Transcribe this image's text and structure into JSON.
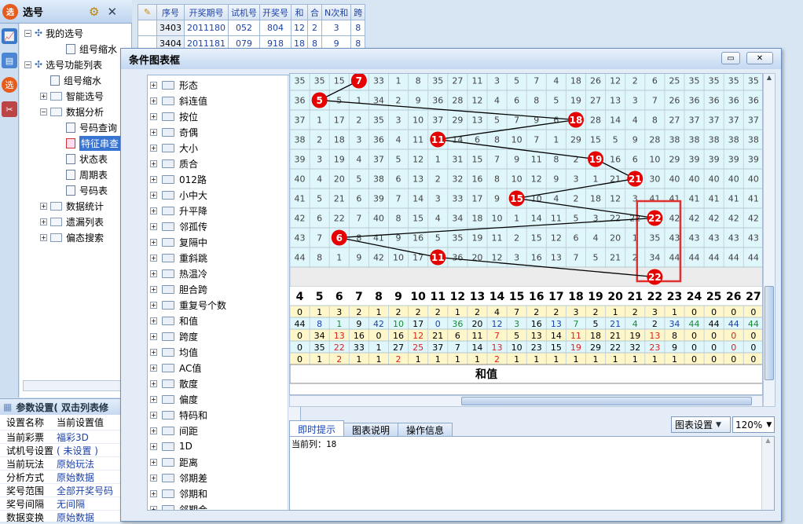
{
  "left_panel": {
    "title": "选号"
  },
  "tree": [
    {
      "label": "我的选号",
      "level": 0,
      "toggle": "−",
      "kind": "node"
    },
    {
      "label": "组号缩水",
      "level": 2,
      "toggle": "",
      "kind": "doc"
    },
    {
      "label": "选号功能列表",
      "level": 0,
      "toggle": "−",
      "kind": "node"
    },
    {
      "label": "组号缩水",
      "level": 1,
      "toggle": "",
      "kind": "doc"
    },
    {
      "label": "智能选号",
      "level": 1,
      "toggle": "+",
      "kind": "folder"
    },
    {
      "label": "数据分析",
      "level": 1,
      "toggle": "−",
      "kind": "folder"
    },
    {
      "label": "号码查询",
      "level": 2,
      "toggle": "",
      "kind": "doc"
    },
    {
      "label": "特征串查",
      "level": 2,
      "toggle": "",
      "kind": "doc",
      "selected": true
    },
    {
      "label": "状态表",
      "level": 2,
      "toggle": "",
      "kind": "doc"
    },
    {
      "label": "周期表",
      "level": 2,
      "toggle": "",
      "kind": "doc"
    },
    {
      "label": "号码表",
      "level": 2,
      "toggle": "",
      "kind": "doc"
    },
    {
      "label": "数据统计",
      "level": 1,
      "toggle": "+",
      "kind": "folder"
    },
    {
      "label": "遗漏列表",
      "level": 1,
      "toggle": "+",
      "kind": "folder"
    },
    {
      "label": "偏态搜索",
      "level": 1,
      "toggle": "+",
      "kind": "folder"
    }
  ],
  "params": {
    "header": "参数设置( 双击列表修",
    "col_name": "设置名称",
    "col_value": "当前设置值",
    "rows": [
      [
        "当前彩票",
        "福彩3D"
      ],
      [
        "试机号设置",
        "( 未设置 )"
      ],
      [
        "当前玩法",
        "原始玩法"
      ],
      [
        "分析方式",
        "原始数据"
      ],
      [
        "奖号范围",
        "全部开奖号码"
      ],
      [
        "奖号间隔",
        "无间隔"
      ],
      [
        "数据变换",
        "原始数据"
      ]
    ]
  },
  "bg_table": {
    "headers": [
      "序号",
      "开奖期号",
      "试机号",
      "开奖号",
      "和",
      "合",
      "N次和",
      "跨"
    ],
    "rows": [
      [
        "3403",
        "2011180",
        "052",
        "804",
        "12",
        "2",
        "3",
        "8"
      ],
      [
        "3404",
        "2011181",
        "079",
        "918",
        "18",
        "8",
        "9",
        "8"
      ]
    ]
  },
  "modal": {
    "title": "条件图表框"
  },
  "conditions": [
    "形态",
    "斜连值",
    "按位",
    "奇偶",
    "大小",
    "质合",
    "012路",
    "小中大",
    "升平降",
    "邻孤传",
    "复隔中",
    "重斜跳",
    "热温冷",
    "胆合跨",
    "重复号个数",
    "和值",
    "跨度",
    "均值",
    "AC值",
    "散度",
    "偏度",
    "特码和",
    "间距",
    "1D",
    "距离",
    "邻期差",
    "邻期和",
    "邻期合"
  ],
  "chart_data": {
    "type": "table",
    "grid_rows": [
      {
        "label": "35",
        "cells": [
          "35",
          "15",
          "7",
          "33",
          "1",
          "8",
          "35",
          "27",
          "11",
          "3",
          "5",
          "7",
          "4",
          "18",
          "26",
          "12",
          "2",
          "6",
          "25",
          "35",
          "35",
          "35",
          "35"
        ]
      },
      {
        "label": "36",
        "cells": [
          "1",
          "5",
          "1",
          "34",
          "2",
          "9",
          "36",
          "28",
          "12",
          "4",
          "6",
          "8",
          "5",
          "19",
          "27",
          "13",
          "3",
          "7",
          "26",
          "36",
          "36",
          "36",
          "36"
        ]
      },
      {
        "label": "37",
        "cells": [
          "1",
          "17",
          "2",
          "35",
          "3",
          "10",
          "37",
          "29",
          "13",
          "5",
          "7",
          "9",
          "6",
          "18",
          "28",
          "14",
          "4",
          "8",
          "27",
          "37",
          "37",
          "37",
          "37"
        ]
      },
      {
        "label": "38",
        "cells": [
          "2",
          "18",
          "3",
          "36",
          "4",
          "11",
          "1",
          "14",
          "6",
          "8",
          "10",
          "7",
          "1",
          "29",
          "15",
          "5",
          "9",
          "28",
          "38",
          "38",
          "38",
          "38",
          "38"
        ]
      },
      {
        "label": "39",
        "cells": [
          "3",
          "19",
          "4",
          "37",
          "5",
          "12",
          "1",
          "31",
          "15",
          "7",
          "9",
          "11",
          "8",
          "2",
          "19",
          "16",
          "6",
          "10",
          "29",
          "39",
          "39",
          "39",
          "39"
        ]
      },
      {
        "label": "40",
        "cells": [
          "4",
          "20",
          "5",
          "38",
          "6",
          "13",
          "2",
          "32",
          "16",
          "8",
          "10",
          "12",
          "9",
          "3",
          "1",
          "21",
          "11",
          "30",
          "40",
          "40",
          "40",
          "40",
          "40"
        ]
      },
      {
        "label": "41",
        "cells": [
          "5",
          "21",
          "6",
          "39",
          "7",
          "14",
          "3",
          "33",
          "17",
          "9",
          "15",
          "10",
          "4",
          "2",
          "18",
          "12",
          "3",
          "41",
          "41",
          "41",
          "41",
          "41",
          "41"
        ]
      },
      {
        "label": "42",
        "cells": [
          "6",
          "22",
          "7",
          "40",
          "8",
          "15",
          "4",
          "34",
          "18",
          "10",
          "1",
          "14",
          "11",
          "5",
          "3",
          "22",
          "22",
          "42",
          "42",
          "42",
          "42",
          "42",
          "42"
        ]
      },
      {
        "label": "43",
        "cells": [
          "7",
          "6",
          "8",
          "41",
          "9",
          "16",
          "5",
          "35",
          "19",
          "11",
          "2",
          "15",
          "12",
          "6",
          "4",
          "20",
          "1",
          "35",
          "43",
          "43",
          "43",
          "43",
          "43"
        ]
      },
      {
        "label": "44",
        "cells": [
          "8",
          "1",
          "9",
          "42",
          "10",
          "17",
          "11",
          "36",
          "20",
          "12",
          "3",
          "16",
          "13",
          "7",
          "5",
          "21",
          "2",
          "34",
          "44",
          "44",
          "44",
          "44",
          "44"
        ]
      }
    ],
    "sum_row": [
      "",
      "",
      "",
      "",
      "",
      "",
      "",
      "",
      "",
      "",
      "",
      "",
      "",
      "",
      "",
      "",
      "",
      "22",
      "",
      "",
      "",
      "",
      ""
    ],
    "x": [
      "4",
      "5",
      "6",
      "7",
      "8",
      "9",
      "10",
      "11",
      "12",
      "13",
      "14",
      "15",
      "16",
      "17",
      "18",
      "19",
      "20",
      "21",
      "22",
      "23",
      "24",
      "25",
      "26",
      "27"
    ],
    "stats": [
      [
        "0",
        "1",
        "3",
        "2",
        "1",
        "2",
        "2",
        "2",
        "1",
        "2",
        "4",
        "7",
        "2",
        "2",
        "3",
        "2",
        "1",
        "2",
        "3",
        "1",
        "0",
        "0",
        "0",
        "0"
      ],
      [
        "44",
        "8",
        "1",
        "9",
        "42",
        "10",
        "17",
        "0",
        "36",
        "20",
        "12",
        "3",
        "16",
        "13",
        "7",
        "5",
        "21",
        "4",
        "2",
        "34",
        "44",
        "44",
        "44",
        "44"
      ],
      [
        "0",
        "34",
        "13",
        "16",
        "0",
        "16",
        "12",
        "21",
        "6",
        "11",
        "7",
        "5",
        "13",
        "14",
        "11",
        "18",
        "21",
        "19",
        "13",
        "8",
        "0",
        "0",
        "0",
        "0"
      ],
      [
        "0",
        "35",
        "22",
        "33",
        "1",
        "27",
        "25",
        "37",
        "7",
        "14",
        "13",
        "10",
        "23",
        "15",
        "19",
        "29",
        "22",
        "32",
        "23",
        "9",
        "0",
        "0",
        "0",
        "0"
      ],
      [
        "0",
        "1",
        "2",
        "1",
        "1",
        "2",
        "1",
        "1",
        "1",
        "1",
        "2",
        "1",
        "1",
        "1",
        "1",
        "1",
        "1",
        "1",
        "1",
        "1",
        "0",
        "0",
        "0",
        "0"
      ]
    ],
    "circles": [
      {
        "label": "7",
        "col": "7",
        "row": "35"
      },
      {
        "label": "5",
        "col": "5",
        "row": "36"
      },
      {
        "label": "18",
        "col": "18",
        "row": "37"
      },
      {
        "label": "11",
        "col": "11",
        "row": "38"
      },
      {
        "label": "19",
        "col": "19",
        "row": "39"
      },
      {
        "label": "21",
        "col": "21",
        "row": "40"
      },
      {
        "label": "15",
        "col": "15",
        "row": "41"
      },
      {
        "label": "22",
        "col": "22",
        "row": "42"
      },
      {
        "label": "6",
        "col": "6",
        "row": "43"
      },
      {
        "label": "11",
        "col": "11",
        "row": "44"
      },
      {
        "label": "22",
        "col": "22",
        "row": "sum"
      }
    ],
    "highlight_column": "22",
    "xlabel": "和值"
  },
  "bottom_tabs": [
    "即时提示",
    "图表说明",
    "操作信息"
  ],
  "tab_active": "即时提示",
  "hint_text": "当前列：18",
  "chart_settings_label": "图表设置",
  "zoom": "120%",
  "colors": {
    "circle": "#e60000",
    "highlight": "#e03030",
    "grid_bg": "#dff6fb",
    "accent": "#1a44b8"
  }
}
